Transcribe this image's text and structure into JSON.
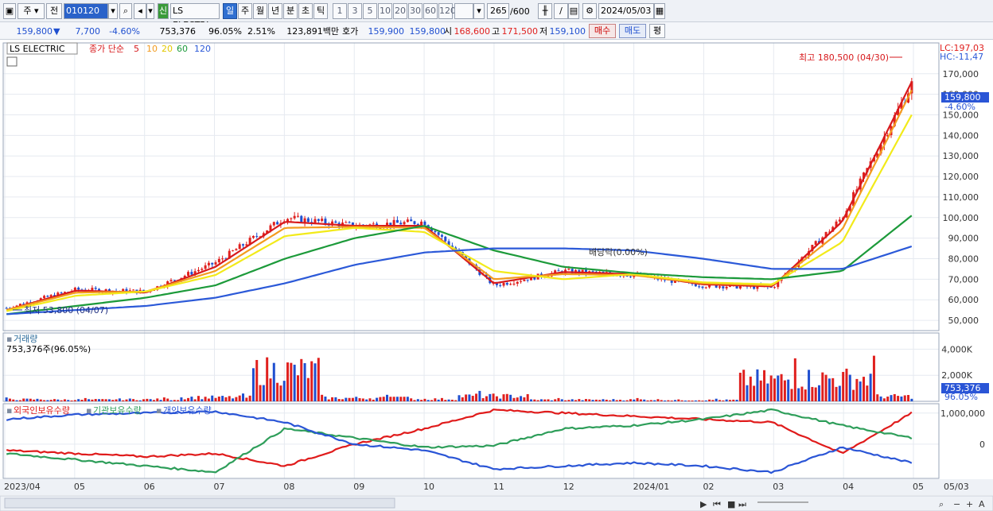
{
  "toolbar": {
    "market_select": "주",
    "prev_label": "전",
    "stock_code": "010120",
    "new_badge": "신",
    "stock_name": "LS ELECTRI",
    "periods": [
      "일",
      "주",
      "월",
      "년",
      "분",
      "초",
      "틱"
    ],
    "active_period": "일",
    "intervals": [
      "1",
      "3",
      "5",
      "10",
      "20",
      "30",
      "60",
      "120"
    ],
    "count_value": "265",
    "count_total": "/600",
    "date_value": "2024/05/03"
  },
  "quote": {
    "price": "159,800",
    "change_arrow": "▼",
    "change": "7,700",
    "change_rate": "-4.60%",
    "volume": "753,376",
    "volume_ratio": "96.05%",
    "turnover_rate": "2.51%",
    "trade_value": "123,891백만",
    "ask_label": "호가",
    "ask": "159,900",
    "bid": "159,800",
    "open_label": "시",
    "open": "168,600",
    "high_label": "고",
    "high": "171,500",
    "low_label": "저",
    "low": "159,100",
    "buy_label": "매수",
    "sell_label": "매도",
    "eval_label": "평"
  },
  "legend": {
    "name": "LS ELECTRIC",
    "ma_title": "종가 단순",
    "ma_periods": [
      "5",
      "10",
      "20",
      "60",
      "120"
    ]
  },
  "price_panel": {
    "lc_label": "LC:197,03",
    "hc_label": "HC:-11,47",
    "y_ticks": [
      "170,000",
      "160,000",
      "150,000",
      "140,000",
      "130,000",
      "120,000",
      "110,000",
      "100,000",
      "90,000",
      "80,000",
      "70,000",
      "60,000",
      "50,000"
    ],
    "current_price_label": "159,800",
    "current_rate_label": "-4.60%",
    "max_annotation": "최고 180,500 (04/30)",
    "min_annotation": "최저 53,800 (04/07)",
    "dividend_annotation": "배당락(0.00%)"
  },
  "volume_panel": {
    "title": "거래량",
    "subtitle": "753,376주(96.05%)",
    "y_ticks": [
      "4,000K",
      "2,000K"
    ],
    "current_label": "753,376",
    "current_rate": "96.05%"
  },
  "holdings_panel": {
    "series_labels": [
      "외국인보유수량",
      "기관보유수량",
      "개인보유수량"
    ],
    "y_ticks": [
      "1,000,000",
      "0"
    ]
  },
  "x_axis": {
    "labels": [
      "2023/04",
      "05",
      "06",
      "07",
      "08",
      "09",
      "10",
      "11",
      "12",
      "2024/01",
      "02",
      "03",
      "04",
      "05",
      "05/03"
    ]
  },
  "colors": {
    "up": "#e0201e",
    "down": "#1f4fd0",
    "ma5": "#d7191c",
    "ma10": "#f39b1f",
    "ma20": "#f2ea1a",
    "ma60": "#1c9a3a",
    "ma120": "#2b59d8",
    "foreign": "#e01b1b",
    "institution": "#2e9e5a",
    "individual": "#2a55d6"
  },
  "chart_data": [
    {
      "type": "line",
      "title": "LS ELECTRIC",
      "subtitle": "종가 단순 5 10 20 60 120",
      "x": [
        "2023/04",
        "05",
        "06",
        "07",
        "08",
        "09",
        "10",
        "11",
        "12",
        "2024/01",
        "02",
        "03",
        "04",
        "05"
      ],
      "series": [
        {
          "name": "종가",
          "values": [
            56000,
            65000,
            64000,
            78000,
            100000,
            96000,
            98000,
            67000,
            74000,
            72000,
            67000,
            66000,
            100000,
            165000
          ]
        },
        {
          "name": "5",
          "values": [
            55000,
            64500,
            63500,
            76000,
            98000,
            96000,
            96000,
            68000,
            73500,
            72500,
            67500,
            66500,
            98000,
            166000
          ]
        },
        {
          "name": "10",
          "values": [
            55000,
            63500,
            64000,
            74000,
            95000,
            95500,
            95000,
            70000,
            72500,
            72000,
            68000,
            67000,
            94000,
            162000
          ]
        },
        {
          "name": "20",
          "values": [
            54500,
            62000,
            64000,
            72000,
            91000,
            95000,
            93000,
            74000,
            70000,
            72500,
            68500,
            67500,
            88000,
            150000
          ]
        },
        {
          "name": "60",
          "values": [
            53000,
            57000,
            61000,
            67000,
            80000,
            90000,
            96000,
            84000,
            76000,
            73000,
            71000,
            70000,
            74000,
            101000
          ]
        },
        {
          "name": "120",
          "values": [
            53000,
            55000,
            57000,
            61000,
            68000,
            77000,
            83000,
            85000,
            85000,
            84000,
            80000,
            75000,
            75000,
            86000
          ]
        }
      ],
      "ylabel": "",
      "ylim": [
        45000,
        185000
      ],
      "annotations": [
        "최고 180,500 (04/30)",
        "최저 53,800 (04/07)",
        "배당락(0.00%)"
      ]
    },
    {
      "type": "bar",
      "title": "거래량",
      "categories": [
        "2023/04",
        "05",
        "06",
        "07",
        "08",
        "09",
        "10",
        "11",
        "12",
        "2024/01",
        "02",
        "03",
        "04",
        "05"
      ],
      "values": [
        300,
        250,
        300,
        600,
        4700,
        500,
        350,
        800,
        250,
        250,
        200,
        3300,
        3500,
        753
      ],
      "ylabel": "K",
      "ylim": [
        0,
        5000
      ]
    },
    {
      "type": "line",
      "title": "외국인보유수량 / 기관보유수량 / 개인보유수량",
      "x": [
        "2023/04",
        "05",
        "06",
        "07",
        "08",
        "09",
        "10",
        "11",
        "12",
        "2024/01",
        "02",
        "03",
        "04",
        "05"
      ],
      "series": [
        {
          "name": "외국인보유수량",
          "values": [
            -200000,
            -300000,
            -400000,
            -300000,
            -700000,
            0,
            500000,
            1100000,
            1000000,
            900000,
            800000,
            700000,
            -300000,
            1000000
          ]
        },
        {
          "name": "기관보유수량",
          "values": [
            -300000,
            -500000,
            -700000,
            -900000,
            500000,
            200000,
            -100000,
            -50000,
            500000,
            600000,
            800000,
            1100000,
            600000,
            200000
          ]
        },
        {
          "name": "개인보유수량",
          "values": [
            800000,
            950000,
            1000000,
            1050000,
            700000,
            0,
            -200000,
            -800000,
            -700000,
            -600000,
            -700000,
            -900000,
            -100000,
            -600000
          ]
        }
      ],
      "ylim": [
        -1100000,
        1300000
      ]
    }
  ]
}
